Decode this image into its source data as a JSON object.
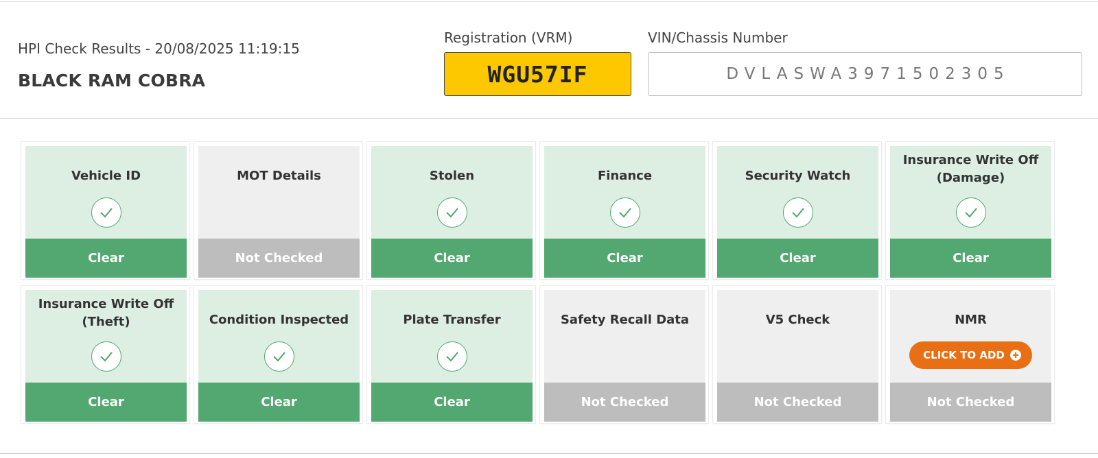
{
  "header": {
    "result_line": "HPI Check Results - 20/08/2025 11:19:15",
    "vehicle_name": "BLACK RAM COBRA",
    "registration_label": "Registration (VRM)",
    "registration_value": "WGU57IF",
    "vin_label": "VIN/Chassis Number",
    "vin_value": "DVLASWA3971502305"
  },
  "colors": {
    "clear_bg": "#ddefe2",
    "clear_status": "#52a870",
    "not_checked_bg": "#efefef",
    "not_checked_status": "#bdbdbd",
    "plate_yellow": "#fdc800",
    "add_button": "#e86f13"
  },
  "cards": [
    {
      "title": "Vehicle ID",
      "status": "Clear",
      "icon": "check-icon"
    },
    {
      "title": "MOT Details",
      "status": "Not Checked",
      "icon": ""
    },
    {
      "title": "Stolen",
      "status": "Clear",
      "icon": "check-icon"
    },
    {
      "title": "Finance",
      "status": "Clear",
      "icon": "check-icon"
    },
    {
      "title": "Security Watch",
      "status": "Clear",
      "icon": "check-icon"
    },
    {
      "title": "Insurance Write Off (Damage)",
      "status": "Clear",
      "icon": "check-icon"
    },
    {
      "title": "Insurance Write Off (Theft)",
      "status": "Clear",
      "icon": "check-icon"
    },
    {
      "title": "Condition Inspected",
      "status": "Clear",
      "icon": "check-icon"
    },
    {
      "title": "Plate Transfer",
      "status": "Clear",
      "icon": "check-icon"
    },
    {
      "title": "Safety Recall Data",
      "status": "Not Checked",
      "icon": ""
    },
    {
      "title": "V5 Check",
      "status": "Not Checked",
      "icon": ""
    },
    {
      "title": "NMR",
      "status": "Not Checked",
      "icon": "",
      "action_label": "CLICK TO ADD"
    }
  ]
}
